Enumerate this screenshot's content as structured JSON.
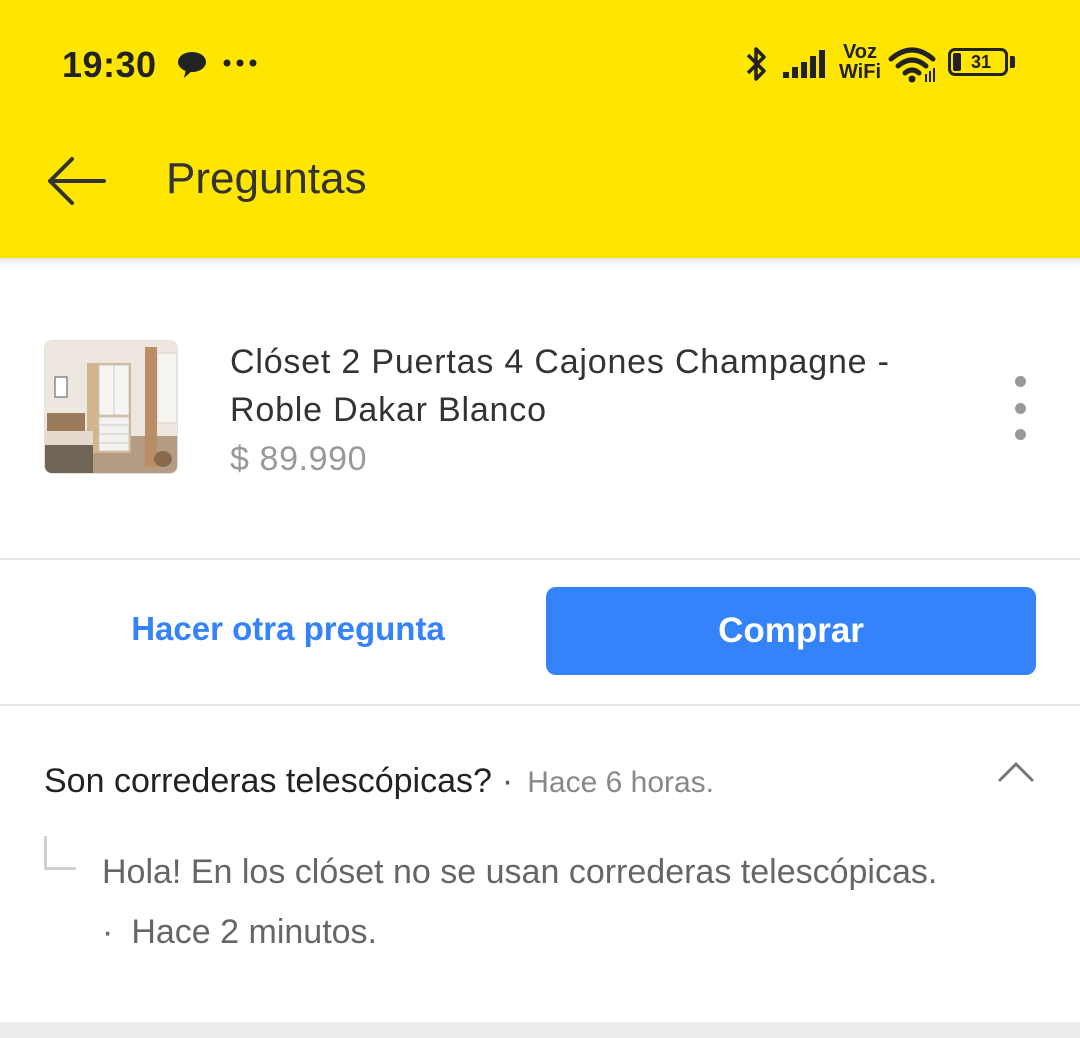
{
  "status_bar": {
    "time": "19:30",
    "icons": [
      "chat-bubble-icon",
      "more-dots-icon",
      "bluetooth-icon",
      "signal-icon",
      "wifi-icon",
      "battery-icon"
    ],
    "vowifi_line1": "Voz",
    "vowifi_line2": "WiFi",
    "battery": "31"
  },
  "header": {
    "title": "Preguntas",
    "back_icon": "arrow-left-icon",
    "background": "#FFE600"
  },
  "product": {
    "title": "Clóset 2 Puertas 4 Cajones Champagne - Roble Dakar Blanco",
    "price": "$ 89.990",
    "thumbnail": "product-thumbnail",
    "menu_icon": "more-vertical-icon"
  },
  "actions": {
    "ask_label": "Hacer otra pregunta",
    "buy_label": "Comprar",
    "accent": "#3483FA"
  },
  "qa": {
    "question": "Son correderas telescópicas?",
    "question_sep": "·",
    "question_time": "Hace 6 horas.",
    "answer": "Hola! En los clóset no se usan correderas telescópicas.",
    "answer_sep": "·",
    "answer_time": "Hace 2 minutos.",
    "collapse_icon": "chevron-up-icon"
  }
}
